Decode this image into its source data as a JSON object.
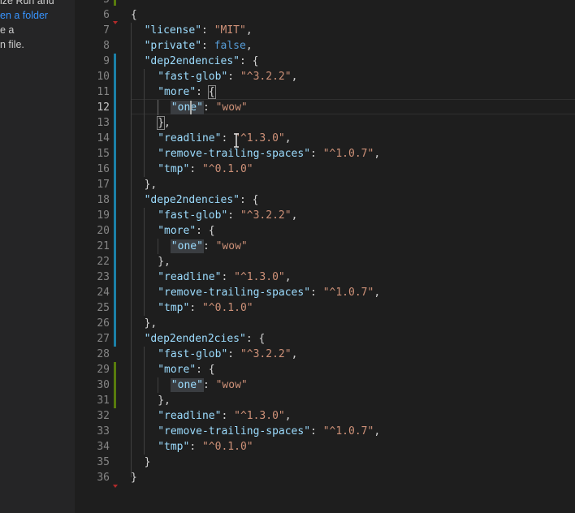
{
  "sidebar": {
    "lines": [
      {
        "text": "ize Run and",
        "link": false
      },
      {
        "text": "en a folder",
        "link": true
      },
      {
        "text": "e a",
        "link": false
      },
      {
        "text": "n file.",
        "link": false
      }
    ]
  },
  "editor": {
    "first_line_number": 5,
    "lines": [
      {
        "n": "5",
        "indent": 0,
        "t": []
      },
      {
        "n": "6",
        "indent": 0,
        "t": [
          [
            "p",
            "{"
          ]
        ]
      },
      {
        "n": "7",
        "indent": 1,
        "t": [
          [
            "k",
            "\"license\""
          ],
          [
            "p",
            ": "
          ],
          [
            "s",
            "\"MIT\""
          ],
          [
            "p",
            ","
          ]
        ]
      },
      {
        "n": "8",
        "indent": 1,
        "t": [
          [
            "k",
            "\"private\""
          ],
          [
            "p",
            ": "
          ],
          [
            "b",
            "false"
          ],
          [
            "p",
            ","
          ]
        ]
      },
      {
        "n": "9",
        "indent": 1,
        "t": [
          [
            "k",
            "\"dep2endencies\""
          ],
          [
            "p",
            ": {"
          ]
        ]
      },
      {
        "n": "10",
        "indent": 2,
        "t": [
          [
            "k",
            "\"fast-glob\""
          ],
          [
            "p",
            ": "
          ],
          [
            "s",
            "\"^3.2.2\""
          ],
          [
            "p",
            ","
          ]
        ]
      },
      {
        "n": "11",
        "indent": 2,
        "t": [
          [
            "k",
            "\"more\""
          ],
          [
            "p",
            ": {"
          ]
        ]
      },
      {
        "n": "12",
        "indent": 3,
        "t": [
          [
            "k",
            "\"one\""
          ],
          [
            "p",
            ": "
          ],
          [
            "s",
            "\"wow\""
          ]
        ]
      },
      {
        "n": "13",
        "indent": 2,
        "t": [
          [
            "p",
            "},"
          ]
        ]
      },
      {
        "n": "14",
        "indent": 2,
        "t": [
          [
            "k",
            "\"readline\""
          ],
          [
            "p",
            ": "
          ],
          [
            "s",
            "\"^1.3.0\""
          ],
          [
            "p",
            ","
          ]
        ]
      },
      {
        "n": "15",
        "indent": 2,
        "t": [
          [
            "k",
            "\"remove-trailing-spaces\""
          ],
          [
            "p",
            ": "
          ],
          [
            "s",
            "\"^1.0.7\""
          ],
          [
            "p",
            ","
          ]
        ]
      },
      {
        "n": "16",
        "indent": 2,
        "t": [
          [
            "k",
            "\"tmp\""
          ],
          [
            "p",
            ": "
          ],
          [
            "s",
            "\"^0.1.0\""
          ]
        ]
      },
      {
        "n": "17",
        "indent": 1,
        "t": [
          [
            "p",
            "},"
          ]
        ]
      },
      {
        "n": "18",
        "indent": 1,
        "t": [
          [
            "k",
            "\"depe2ndencies\""
          ],
          [
            "p",
            ": {"
          ]
        ]
      },
      {
        "n": "19",
        "indent": 2,
        "t": [
          [
            "k",
            "\"fast-glob\""
          ],
          [
            "p",
            ": "
          ],
          [
            "s",
            "\"^3.2.2\""
          ],
          [
            "p",
            ","
          ]
        ]
      },
      {
        "n": "20",
        "indent": 2,
        "t": [
          [
            "k",
            "\"more\""
          ],
          [
            "p",
            ": {"
          ]
        ]
      },
      {
        "n": "21",
        "indent": 3,
        "t": [
          [
            "k",
            "\"one\""
          ],
          [
            "p",
            ": "
          ],
          [
            "s",
            "\"wow\""
          ]
        ]
      },
      {
        "n": "22",
        "indent": 2,
        "t": [
          [
            "p",
            "},"
          ]
        ]
      },
      {
        "n": "23",
        "indent": 2,
        "t": [
          [
            "k",
            "\"readline\""
          ],
          [
            "p",
            ": "
          ],
          [
            "s",
            "\"^1.3.0\""
          ],
          [
            "p",
            ","
          ]
        ]
      },
      {
        "n": "24",
        "indent": 2,
        "t": [
          [
            "k",
            "\"remove-trailing-spaces\""
          ],
          [
            "p",
            ": "
          ],
          [
            "s",
            "\"^1.0.7\""
          ],
          [
            "p",
            ","
          ]
        ]
      },
      {
        "n": "25",
        "indent": 2,
        "t": [
          [
            "k",
            "\"tmp\""
          ],
          [
            "p",
            ": "
          ],
          [
            "s",
            "\"^0.1.0\""
          ]
        ]
      },
      {
        "n": "26",
        "indent": 1,
        "t": [
          [
            "p",
            "},"
          ]
        ]
      },
      {
        "n": "27",
        "indent": 1,
        "t": [
          [
            "k",
            "\"dep2enden2cies\""
          ],
          [
            "p",
            ": {"
          ]
        ]
      },
      {
        "n": "28",
        "indent": 2,
        "t": [
          [
            "k",
            "\"fast-glob\""
          ],
          [
            "p",
            ": "
          ],
          [
            "s",
            "\"^3.2.2\""
          ],
          [
            "p",
            ","
          ]
        ]
      },
      {
        "n": "29",
        "indent": 2,
        "t": [
          [
            "k",
            "\"more\""
          ],
          [
            "p",
            ": {"
          ]
        ]
      },
      {
        "n": "30",
        "indent": 3,
        "t": [
          [
            "k",
            "\"one\""
          ],
          [
            "p",
            ": "
          ],
          [
            "s",
            "\"wow\""
          ]
        ]
      },
      {
        "n": "31",
        "indent": 2,
        "t": [
          [
            "p",
            "},"
          ]
        ]
      },
      {
        "n": "32",
        "indent": 2,
        "t": [
          [
            "k",
            "\"readline\""
          ],
          [
            "p",
            ": "
          ],
          [
            "s",
            "\"^1.3.0\""
          ],
          [
            "p",
            ","
          ]
        ]
      },
      {
        "n": "33",
        "indent": 2,
        "t": [
          [
            "k",
            "\"remove-trailing-spaces\""
          ],
          [
            "p",
            ": "
          ],
          [
            "s",
            "\"^1.0.7\""
          ],
          [
            "p",
            ","
          ]
        ]
      },
      {
        "n": "34",
        "indent": 2,
        "t": [
          [
            "k",
            "\"tmp\""
          ],
          [
            "p",
            ": "
          ],
          [
            "s",
            "\"^0.1.0\""
          ]
        ]
      },
      {
        "n": "35",
        "indent": 1,
        "t": [
          [
            "p",
            "}"
          ]
        ]
      },
      {
        "n": "36",
        "indent": 0,
        "t": [
          [
            "p",
            "}"
          ]
        ]
      }
    ],
    "cursor_line": "12",
    "modified_lines_blue": [
      "9-27"
    ],
    "modified_lines_green": [
      "29-31"
    ],
    "colors": {
      "background": "#1e1e1e",
      "key": "#9cdcfe",
      "string": "#ce9178",
      "boolean": "#569cd6",
      "punctuation": "#d4d4d4",
      "line_number": "#858585",
      "gutter_modified": "#1b81a8",
      "gutter_added": "#587c0c"
    }
  }
}
